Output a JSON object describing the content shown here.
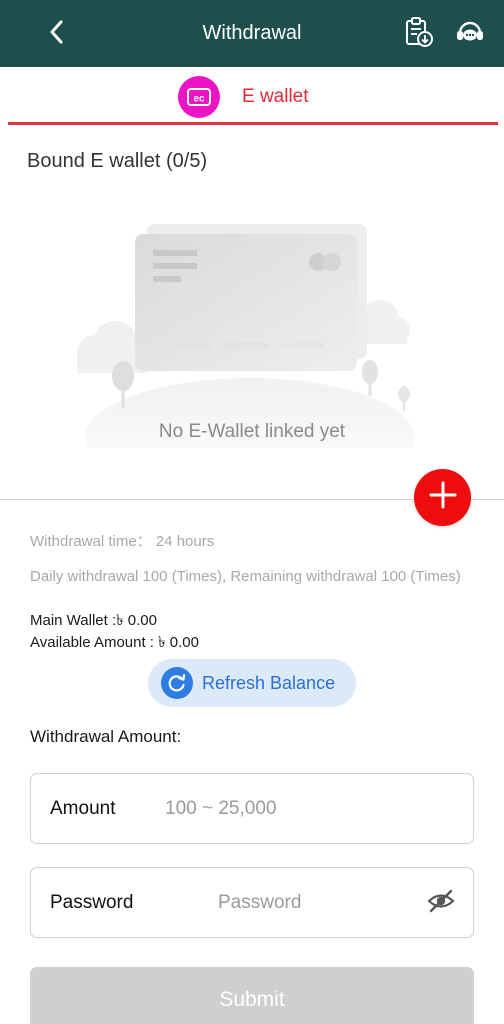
{
  "header": {
    "title": "Withdrawal",
    "back_icon": "chevron-left-icon",
    "records_icon": "clipboard-download-icon",
    "support_icon": "customer-service-icon",
    "background_color": "#1e4e4e"
  },
  "tabs": [
    {
      "label": "E wallet",
      "icon": "e-wallet-icon",
      "active": true,
      "accent_color": "#e02a38",
      "icon_color": "#ec14c4"
    }
  ],
  "bound_section": {
    "title": "Bound E wallet (0/5)",
    "empty_message": "No E-Wallet linked yet",
    "add_icon": "plus-icon",
    "add_button_color": "#ee0d0d"
  },
  "info": {
    "withdrawal_time": "Withdrawal time：  24 hours",
    "daily_limit": "Daily withdrawal 100 (Times), Remaining withdrawal 100 (Times)",
    "main_wallet": "Main Wallet :৳ 0.00",
    "available_amount": "Available Amount : ৳ 0.00"
  },
  "refresh": {
    "label": "Refresh Balance",
    "icon": "refresh-icon",
    "color": "#2f7ce2"
  },
  "form": {
    "heading": "Withdrawal Amount:",
    "amount": {
      "label": "Amount",
      "placeholder": "100 ~ 25,000",
      "value": ""
    },
    "password": {
      "label": "Password",
      "placeholder": "Password",
      "value": "",
      "toggle_icon": "eye-off-icon"
    },
    "submit_label": "Submit",
    "submit_disabled": true
  }
}
